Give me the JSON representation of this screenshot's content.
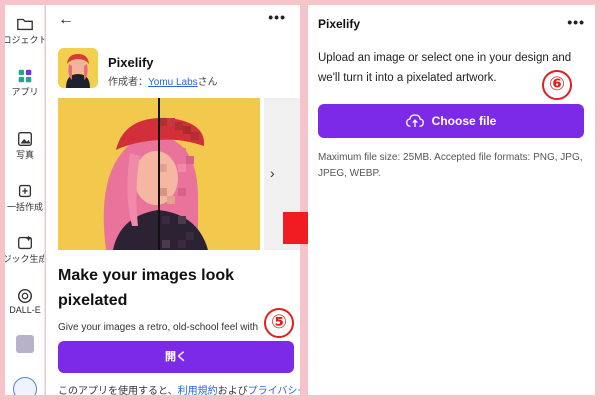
{
  "sidebar": {
    "items": [
      {
        "label": "ロジェクト",
        "icon": "folder-icon"
      },
      {
        "label": "アプリ",
        "icon": "apps-icon"
      },
      {
        "label": "写真",
        "icon": "photo-icon"
      },
      {
        "label": "一括作成",
        "icon": "bulk-create-icon"
      },
      {
        "label": "ジック生成",
        "icon": "magic-generate-icon"
      },
      {
        "label": "DALL-E",
        "icon": "dalle-icon"
      },
      {
        "label": "",
        "icon": "app-thumbnail-icon"
      }
    ]
  },
  "left_panel": {
    "app_name": "Pixelify",
    "author_prefix": "作成者：",
    "author_name": "Yomu Labs",
    "author_suffix": "さん",
    "headline": "Make your images look pixelated",
    "description": "Give your images a retro, old-school feel with",
    "open_button": "開く",
    "terms_prefix": "このアプリを使用すると、",
    "terms_link": "利用規約",
    "terms_middle": "および",
    "privacy_link": "プライバシーポリ"
  },
  "right_panel": {
    "title": "Pixelify",
    "upload_text": "Upload an image or select one in your design and we'll turn it into a pixelated artwork.",
    "choose_button": "Choose file",
    "file_info": "Maximum file size: 25MB. Accepted file formats: PNG, JPG, JPEG, WEBP."
  },
  "badges": {
    "step5": "⑤",
    "step6": "⑥"
  },
  "colors": {
    "background": "#f6c4c8",
    "accent_purple": "#7d2ae8",
    "badge_red": "#e0201f",
    "arrow_red": "#f01c22",
    "banner_yellow": "#f2c94c"
  }
}
